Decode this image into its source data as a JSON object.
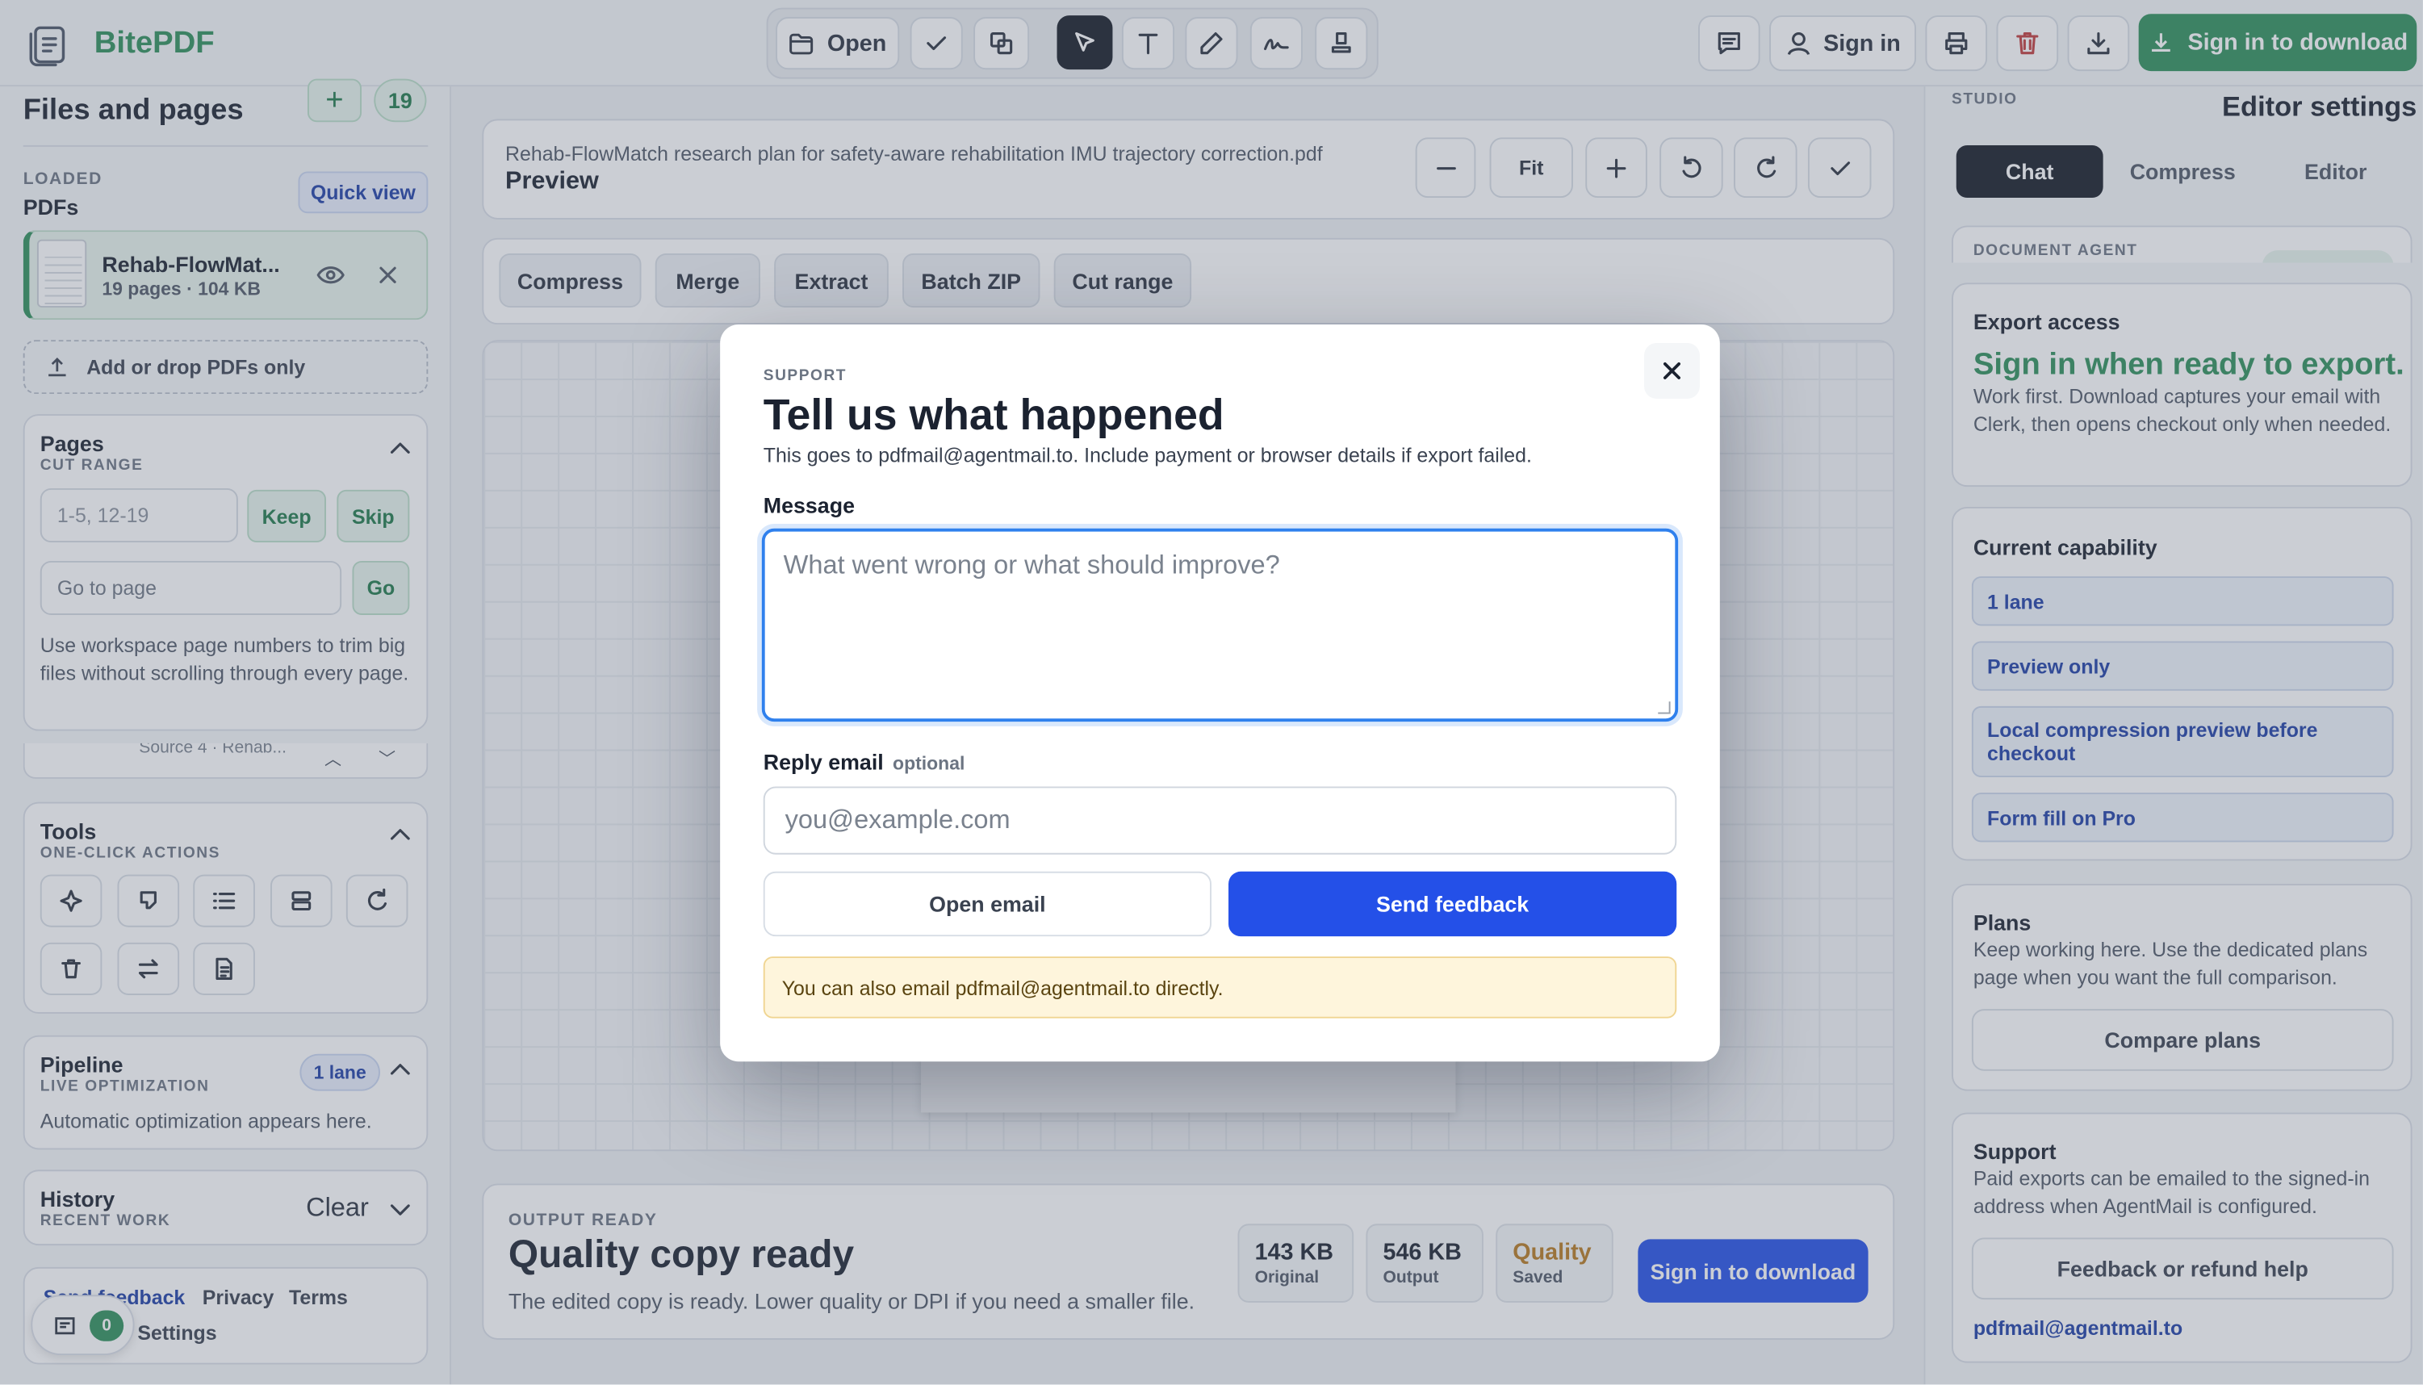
{
  "brand": {
    "name": "BitePDF"
  },
  "toolbar": {
    "open_label": "Open",
    "sign_in_label": "Sign in",
    "download_label": "Sign in to download"
  },
  "sidebar": {
    "title": "Files and pages",
    "file_count": "19",
    "loaded_caption": "LOADED",
    "pdfs_label": "PDFs",
    "quick_view_label": "Quick view",
    "file": {
      "name": "Rehab-FlowMat...",
      "meta": "19 pages · 104 KB"
    },
    "add_drop_label": "Add or drop PDFs only",
    "pages": {
      "title": "Pages",
      "subtitle": "CUT RANGE",
      "range_placeholder": "1-5, 12-19",
      "keep_label": "Keep",
      "skip_label": "Skip",
      "goto_placeholder": "Go to page",
      "go_label": "Go",
      "help": "Use workspace page numbers to trim big files without scrolling through every page.",
      "peek_label": "Source 4 · Rehab..."
    },
    "tools": {
      "title": "Tools",
      "subtitle": "ONE-CLICK ACTIONS"
    },
    "pipeline": {
      "title": "Pipeline",
      "subtitle": "LIVE OPTIMIZATION",
      "badge": "1 lane",
      "text": "Automatic optimization appears here."
    },
    "history": {
      "title": "History",
      "subtitle": "RECENT WORK",
      "clear_label": "Clear"
    },
    "footer": {
      "feedback_label": "Send feedback",
      "privacy_label": "Privacy",
      "terms_label": "Terms",
      "settings_label": "Settings",
      "notif_count": "0"
    }
  },
  "main": {
    "filename": "Rehab-FlowMatch research plan for safety-aware rehabilitation IMU trajectory correction.pdf",
    "preview_label": "Preview",
    "fit_label": "Fit",
    "actions": [
      "Compress",
      "Merge",
      "Extract",
      "Batch ZIP",
      "Cut range"
    ],
    "output": {
      "caption": "OUTPUT READY",
      "title": "Quality copy ready",
      "text": "The edited copy is ready. Lower quality or DPI if you need a smaller file.",
      "stats": [
        {
          "value": "143 KB",
          "label": "Original"
        },
        {
          "value": "546 KB",
          "label": "Output"
        },
        {
          "value": "Quality",
          "label": "Saved"
        }
      ],
      "download_label": "Sign in to download"
    }
  },
  "right": {
    "studio_caption": "STUDIO",
    "title": "Editor settings",
    "tabs": [
      "Chat",
      "Compress",
      "Editor"
    ],
    "doc_agent_caption": "DOCUMENT AGENT",
    "export": {
      "title": "Export access",
      "headline": "Sign in when ready to export.",
      "text": "Work first. Download captures your email with Clerk, then opens checkout only when needed."
    },
    "capability": {
      "title": "Current capability",
      "items": [
        "1 lane",
        "Preview only",
        "Local compression preview before checkout",
        "Form fill on Pro"
      ]
    },
    "plans": {
      "title": "Plans",
      "text": "Keep working here. Use the dedicated plans page when you want the full comparison.",
      "button_label": "Compare plans"
    },
    "support": {
      "title": "Support",
      "text": "Paid exports can be emailed to the signed-in address when AgentMail is configured.",
      "button_label": "Feedback or refund help",
      "email": "pdfmail@agentmail.to"
    }
  },
  "modal": {
    "caption": "SUPPORT",
    "title": "Tell us what happened",
    "subtitle": "This goes to pdfmail@agentmail.to. Include payment or browser details if export failed.",
    "message_label": "Message",
    "message_placeholder": "What went wrong or what should improve?",
    "email_label": "Reply email",
    "email_optional": "optional",
    "email_placeholder": "you@example.com",
    "open_email_label": "Open email",
    "send_label": "Send feedback",
    "note": "You can also email pdfmail@agentmail.to directly."
  },
  "colors": {
    "brand_green": "#2f8f5b",
    "accent_blue": "#2450e8",
    "dark": "#151b26"
  }
}
